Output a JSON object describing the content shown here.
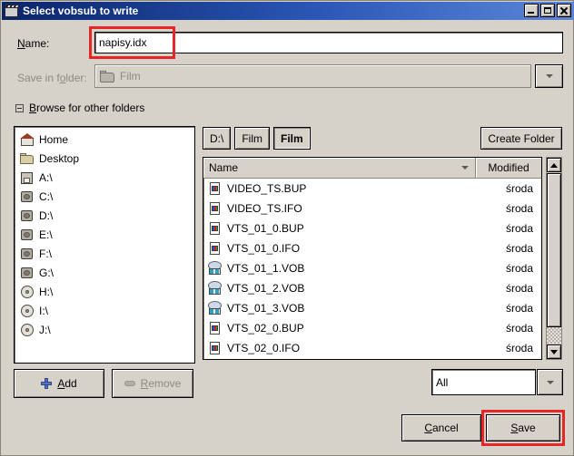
{
  "window": {
    "title": "Select vobsub to write",
    "icon": "film-clapper-icon",
    "controls": {
      "minimize": "_",
      "maximize": "□",
      "close": "✕"
    }
  },
  "name_row": {
    "label": "Name:",
    "value": "napisy.idx",
    "highlight_color": "#e82626"
  },
  "save_in_folder": {
    "label": "Save in folder:",
    "value": "Film",
    "disabled": true,
    "dropdown_icon": "chevron-down-icon"
  },
  "expander": {
    "label": "Browse for other folders",
    "expanded": true,
    "sign": "minus-box-icon"
  },
  "places": [
    {
      "label": "Home",
      "icon": "home-icon"
    },
    {
      "label": "Desktop",
      "icon": "folder-icon"
    },
    {
      "label": "A:\\",
      "icon": "floppy-icon"
    },
    {
      "label": "C:\\",
      "icon": "harddisk-icon"
    },
    {
      "label": "D:\\",
      "icon": "harddisk-icon"
    },
    {
      "label": "E:\\",
      "icon": "harddisk-icon"
    },
    {
      "label": "F:\\",
      "icon": "harddisk-icon"
    },
    {
      "label": "G:\\",
      "icon": "harddisk-icon"
    },
    {
      "label": "H:\\",
      "icon": "cdrom-icon"
    },
    {
      "label": "I:\\",
      "icon": "cdrom-icon"
    },
    {
      "label": "J:\\",
      "icon": "cdrom-icon"
    }
  ],
  "path_buttons": [
    {
      "label": "D:\\",
      "active": false
    },
    {
      "label": "Film",
      "active": false
    },
    {
      "label": "Film",
      "active": true
    }
  ],
  "create_folder_button": "Create Folder",
  "file_list": {
    "columns": {
      "name": "Name",
      "modified": "Modified"
    },
    "sort_icon": "chevron-down-icon",
    "rows": [
      {
        "name": "VIDEO_TS.BUP",
        "modified": "środa",
        "icon": "document-icon"
      },
      {
        "name": "VIDEO_TS.IFO",
        "modified": "środa",
        "icon": "document-icon"
      },
      {
        "name": "VTS_01_0.BUP",
        "modified": "środa",
        "icon": "document-icon"
      },
      {
        "name": "VTS_01_0.IFO",
        "modified": "środa",
        "icon": "document-icon"
      },
      {
        "name": "VTS_01_1.VOB",
        "modified": "środa",
        "icon": "media-icon"
      },
      {
        "name": "VTS_01_2.VOB",
        "modified": "środa",
        "icon": "media-icon"
      },
      {
        "name": "VTS_01_3.VOB",
        "modified": "środa",
        "icon": "media-icon"
      },
      {
        "name": "VTS_02_0.BUP",
        "modified": "środa",
        "icon": "document-icon"
      },
      {
        "name": "VTS_02_0.IFO",
        "modified": "środa",
        "icon": "document-icon"
      }
    ]
  },
  "scrollbar": {
    "up_icon": "triangle-up-icon",
    "down_icon": "triangle-down-icon"
  },
  "bottom": {
    "add_label": "Add",
    "add_icon": "plus-icon",
    "remove_label": "Remove",
    "remove_icon": "minus-icon",
    "remove_disabled": true,
    "filter_value": "All",
    "filter_icon": "chevron-down-icon",
    "cancel_label": "Cancel",
    "save_label": "Save",
    "save_highlight_color": "#e82626"
  }
}
